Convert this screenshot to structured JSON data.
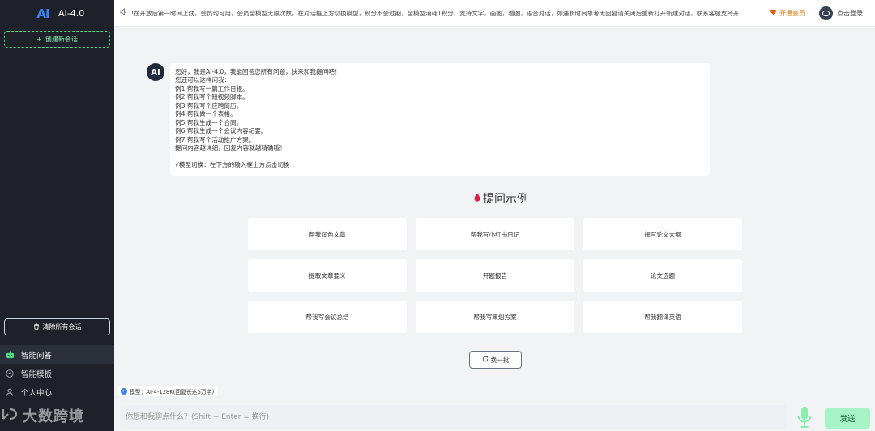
{
  "app": {
    "logo_text": "AI",
    "name": "AI-4.0"
  },
  "sidebar": {
    "new_chat_label": "创建新会话",
    "clear_chats_label": "清除所有会话",
    "nav": [
      {
        "label": "智能问答",
        "icon": "robot-icon",
        "active": true
      },
      {
        "label": "智能模板",
        "icon": "compass-icon",
        "active": false
      },
      {
        "label": "个人中心",
        "icon": "user-icon",
        "active": false
      }
    ],
    "watermark_text": "大数跨境"
  },
  "topbar": {
    "notice": "!在开放后第一时间上线，会员均可用，会员全模型无限次数，在对话框上方切换模型，积分不会过期，全模型消耗1积分，支持文字，画图，看图，语音对话，如遇长时间思考无回复请关闭后重新打开新建对话，联系客服支持开",
    "vip_label": "开通会员",
    "login_label": "点击登录"
  },
  "bot": {
    "avatar_text": "AI"
  },
  "message": {
    "lines": [
      "您好，我是AI-4.0，我能回答您所有问题，快来和我提问吧！",
      "您还可以这样问我：",
      "例1.帮我写一篇工作日报。",
      "例2.帮我写个短视频脚本。",
      "例3.帮我写个应聘简历。",
      "例4.帮我做一个表格。",
      "例5.帮我生成一个合同。",
      "例6.帮我生成一个会议内容纪要。",
      "例7.帮我写个活动推广方案。",
      "提问内容越详细，回复内容就越精确哦！"
    ],
    "footer": "√模型切换：在下方的输入框上方点击切换"
  },
  "examples": {
    "title": "提问示例",
    "items": [
      "帮我润色文章",
      "帮我写小红书日记",
      "撰写论文大纲",
      "提取文章要义",
      "开题报告",
      "论文选题",
      "帮我写会议总结",
      "帮我写策划方案",
      "帮我翻译英语"
    ],
    "refresh_label": "换一批"
  },
  "composer": {
    "model_label": "模型：AI-4-128K(回复长达6万字)",
    "placeholder": "你想和我聊点什么？(Shift + Enter = 换行)",
    "send_label": "发送"
  },
  "colors": {
    "sidebar_bg": "#1e2129",
    "accent_green": "#4ade80",
    "send_bg": "#a7f3c5",
    "vip": "#d97706"
  }
}
